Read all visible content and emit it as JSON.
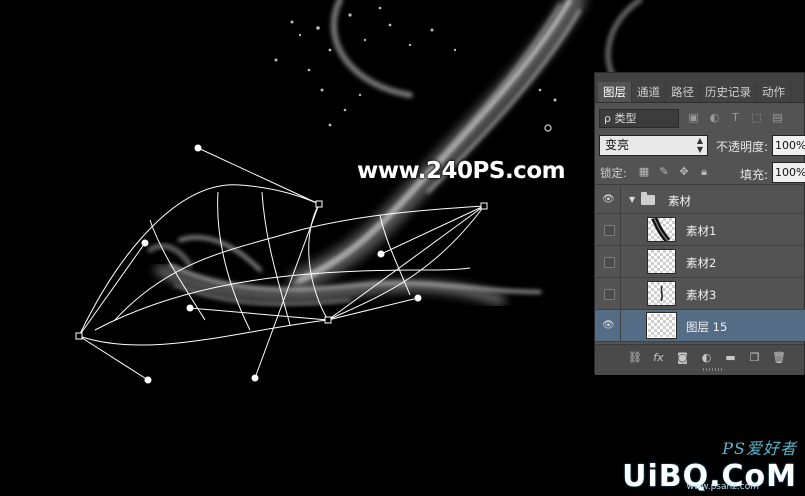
{
  "watermark_text": "www.240PS.com",
  "brand": {
    "top": "PS爱好者",
    "main": "UiBQ.CoM",
    "sub": "www.psahz.com"
  },
  "layers_panel": {
    "tabs": [
      {
        "label": "图层",
        "active": true
      },
      {
        "label": "通道",
        "active": false
      },
      {
        "label": "路径",
        "active": false
      },
      {
        "label": "历史记录",
        "active": false
      },
      {
        "label": "动作",
        "active": false
      }
    ],
    "filter": {
      "label": "ρ 类型"
    },
    "blend_mode": "变亮",
    "opacity_label": "不透明度:",
    "opacity_value": "100%",
    "lock_label": "锁定:",
    "fill_label": "填充:",
    "fill_value": "100%",
    "group": {
      "name": "素材",
      "visible": true,
      "expanded": true
    },
    "layers": [
      {
        "name": "素材1",
        "visible": false,
        "selected": false
      },
      {
        "name": "素材2",
        "visible": false,
        "selected": false
      },
      {
        "name": "素材3",
        "visible": false,
        "selected": false
      },
      {
        "name": "图层 15",
        "visible": true,
        "selected": true
      }
    ],
    "icons": {
      "filter": [
        "image-filter-icon",
        "adjustment-filter-icon",
        "type-filter-icon",
        "shape-filter-icon",
        "smart-object-filter-icon"
      ],
      "lock": [
        "lock-transparent-pixels-icon",
        "lock-image-pixels-icon",
        "lock-position-icon",
        "lock-all-icon"
      ],
      "bottom": [
        "link-layers-icon",
        "fx-icon",
        "add-mask-icon",
        "adjustment-layer-icon",
        "new-group-icon",
        "new-layer-icon",
        "trash-icon"
      ]
    }
  },
  "colors": {
    "canvas_bg": "#000000",
    "panel_bg": "#535353",
    "selected_layer": "#556c87",
    "brand_accent": "#58b8d0"
  }
}
